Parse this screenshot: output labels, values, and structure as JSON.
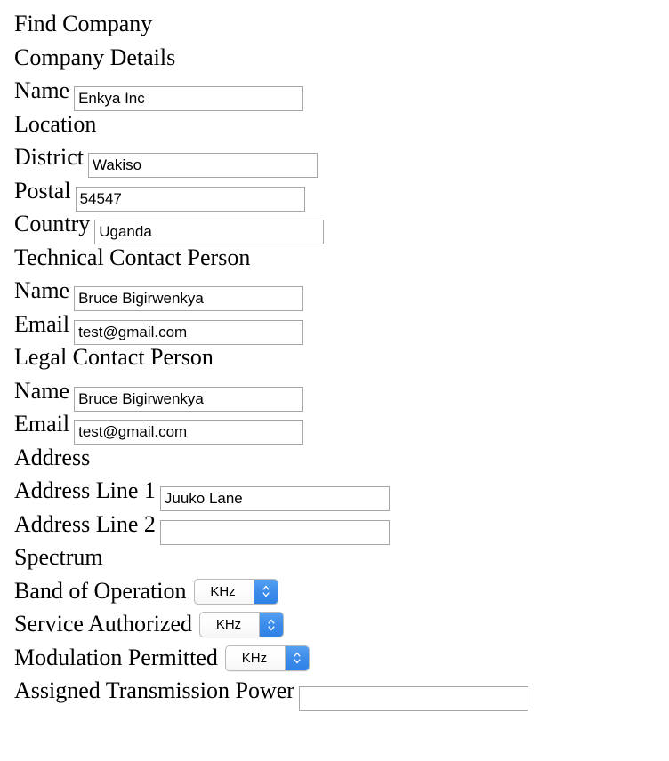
{
  "page": {
    "title": "Find Company"
  },
  "sections": {
    "company_details": {
      "heading": "Company Details",
      "name_label": "Name",
      "name_value": "Enkya Inc"
    },
    "location": {
      "heading": "Location",
      "district_label": "District",
      "district_value": "Wakiso",
      "postal_label": "Postal",
      "postal_value": "54547",
      "country_label": "Country",
      "country_value": "Uganda"
    },
    "technical_contact": {
      "heading": "Technical Contact Person",
      "name_label": "Name",
      "name_value": "Bruce Bigirwenkya",
      "email_label": "Email",
      "email_value": "test@gmail.com"
    },
    "legal_contact": {
      "heading": "Legal Contact Person",
      "name_label": "Name",
      "name_value": "Bruce Bigirwenkya",
      "email_label": "Email",
      "email_value": "test@gmail.com"
    },
    "address": {
      "heading": "Address",
      "line1_label": "Address Line 1",
      "line1_value": "Juuko Lane",
      "line2_label": "Address Line 2",
      "line2_value": ""
    },
    "spectrum": {
      "heading": "Spectrum",
      "band_label": "Band of Operation",
      "band_value": "KHz",
      "service_label": "Service Authorized",
      "service_value": "KHz",
      "modulation_label": "Modulation Permitted",
      "modulation_value": "KHz",
      "power_label": "Assigned Transmission Power",
      "power_value": ""
    }
  },
  "icons": {
    "stepper": "chevron-up-down-icon"
  },
  "colors": {
    "select_button_blue": "#3c8ce9",
    "input_border": "#a6a6a6",
    "text": "#000000",
    "background": "#ffffff"
  }
}
